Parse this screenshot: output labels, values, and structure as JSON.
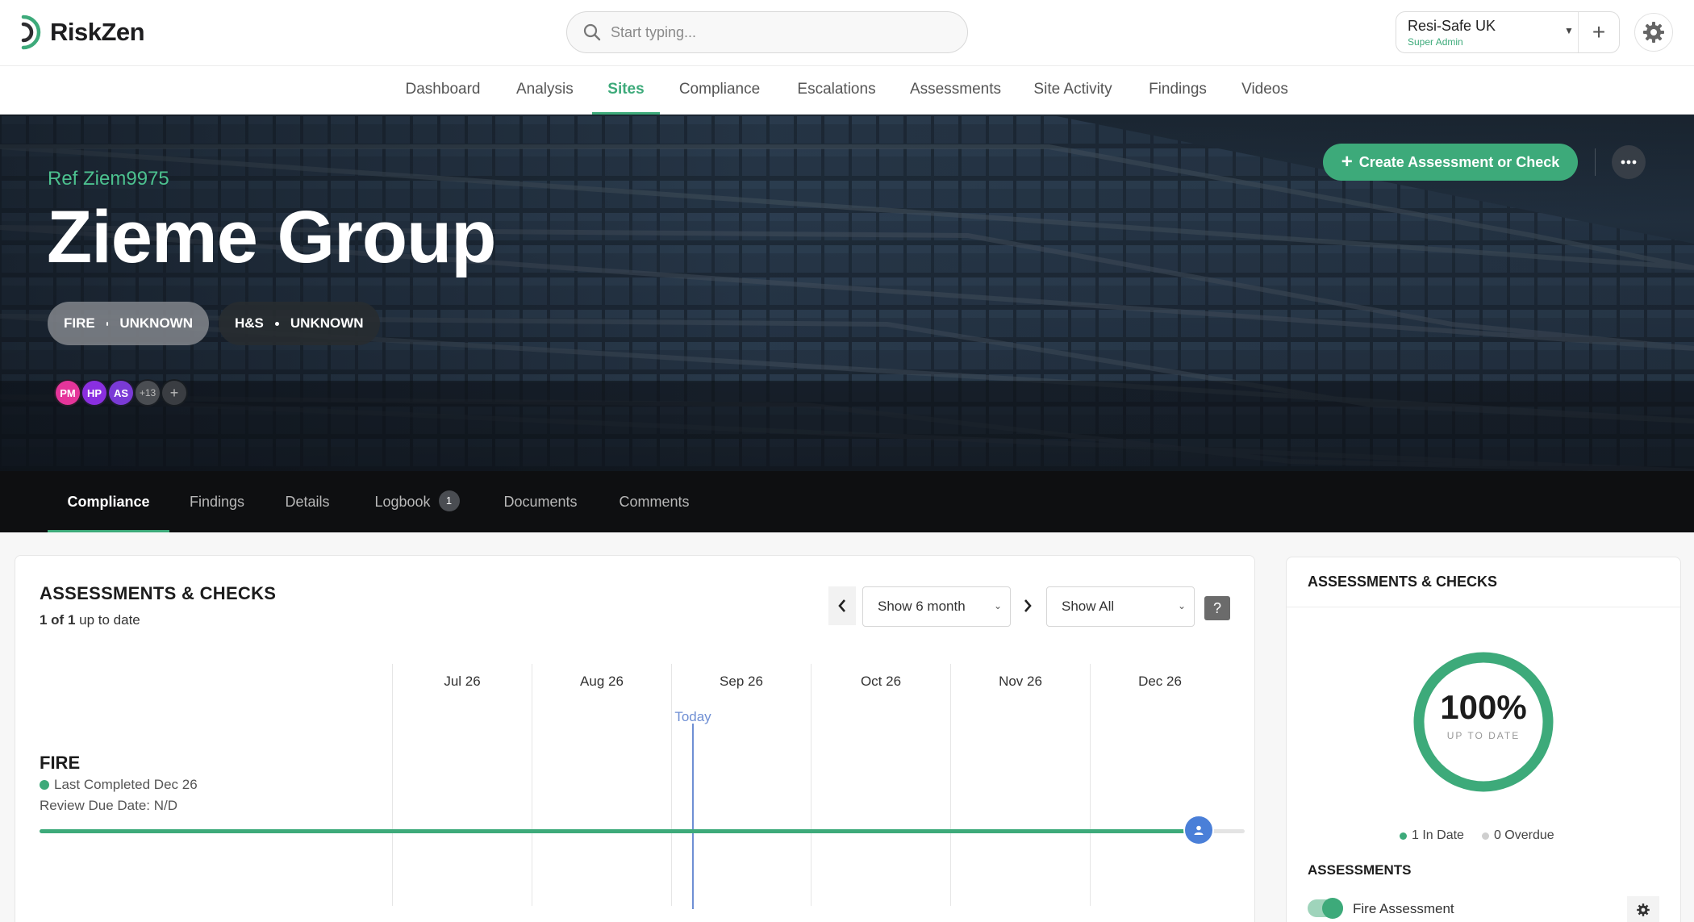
{
  "brand": {
    "name": "RiskZen",
    "accent": "#3daa7a"
  },
  "search": {
    "placeholder": "Start typing..."
  },
  "org": {
    "name": "Resi-Safe UK",
    "role": "Super Admin"
  },
  "nav": {
    "items": [
      {
        "label": "Dashboard"
      },
      {
        "label": "Analysis"
      },
      {
        "label": "Sites",
        "active": true
      },
      {
        "label": "Compliance"
      },
      {
        "label": "Escalations"
      },
      {
        "label": "Assessments"
      },
      {
        "label": "Site Activity"
      },
      {
        "label": "Findings"
      },
      {
        "label": "Videos"
      }
    ]
  },
  "site": {
    "ref": "Ref Ziem9975",
    "name": "Zieme Group",
    "statuses": [
      {
        "type": "FIRE",
        "status": "UNKNOWN"
      },
      {
        "type": "H&S",
        "status": "UNKNOWN"
      }
    ],
    "avatars": [
      {
        "initials": "PM",
        "color": "#e5359a"
      },
      {
        "initials": "HP",
        "color": "#8a2fe0"
      },
      {
        "initials": "AS",
        "color": "#7a3ad6"
      },
      {
        "initials": "+13",
        "color": "#4a4d52"
      }
    ],
    "create_label": "Create Assessment or Check"
  },
  "subtabs": [
    {
      "label": "Compliance",
      "active": true
    },
    {
      "label": "Findings"
    },
    {
      "label": "Details"
    },
    {
      "label": "Logbook",
      "badge": "1"
    },
    {
      "label": "Documents"
    },
    {
      "label": "Comments"
    }
  ],
  "assessments": {
    "title": "ASSESSMENTS & CHECKS",
    "summary_count": "1 of 1",
    "summary_text": "up to date",
    "range_select": "Show 6 month",
    "filter_select": "Show All",
    "help": "?",
    "months": [
      "Jul 26",
      "Aug 26",
      "Sep 26",
      "Oct 26",
      "Nov 26",
      "Dec 26"
    ],
    "today_label": "Today",
    "rows": [
      {
        "name": "FIRE",
        "last_completed": "Last Completed Dec 26",
        "review_due": "Review Due Date: N/D",
        "progress": 0.97
      }
    ]
  },
  "side": {
    "title": "ASSESSMENTS & CHECKS",
    "percent": "100%",
    "percent_value": 1.0,
    "percent_label": "UP TO DATE",
    "in_date": "1 In Date",
    "overdue": "0 Overdue",
    "section": "ASSESSMENTS",
    "items": [
      {
        "label": "Fire Assessment",
        "enabled": true
      }
    ]
  }
}
